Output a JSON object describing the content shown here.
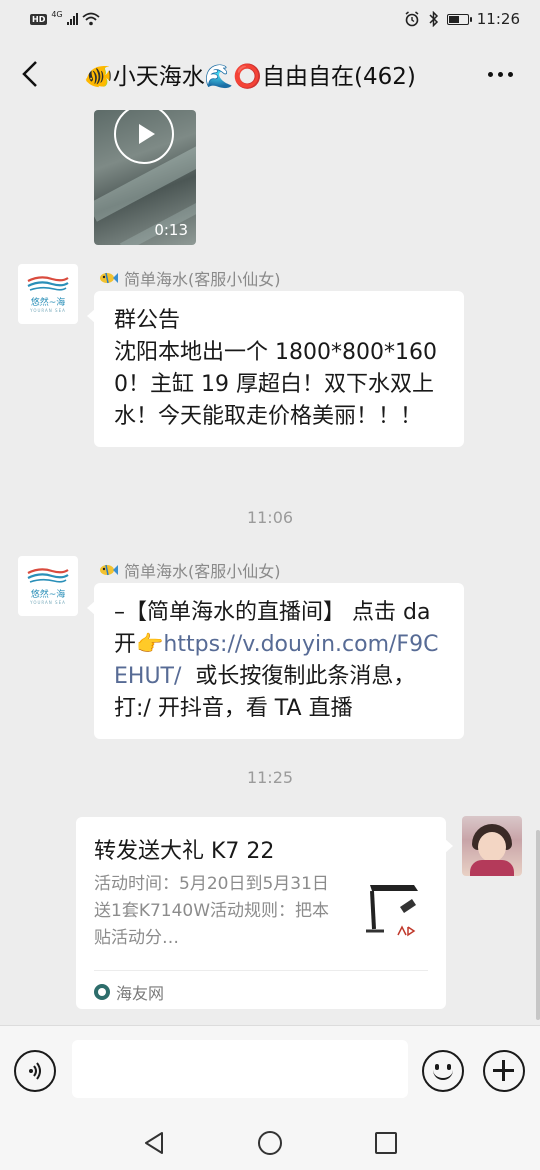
{
  "status_bar": {
    "hd": "HD",
    "network": "4G",
    "time": "11:26",
    "battery_level": 0.55
  },
  "header": {
    "title": "🐠小天海水🌊⭕自由自在(462)"
  },
  "chat": {
    "video": {
      "duration": "0:13"
    },
    "messages": [
      {
        "avatar_text": "悠然~海",
        "avatar_sub": "YOURAN SEA",
        "sender": "简单海水(客服小仙女)",
        "text": "群公告\n沈阳本地出一个 1800*800*1600！主缸 19 厚超白！双下水双上水！今天能取走价格美丽！！！"
      },
      {
        "timestamp": "11:06"
      },
      {
        "avatar_text": "悠然~海",
        "avatar_sub": "YOURAN SEA",
        "sender": "简单海水(客服小仙女)",
        "text_before": "–【简单海水的直播间】 点击 da 开",
        "link": "https://v.douyin.com/F9CEHUT/",
        "text_after": "  或长按復制此条消息，打:/ 开抖音，看 TA 直播"
      },
      {
        "timestamp": "11:25"
      }
    ],
    "share_card": {
      "title": "转发送大礼 K7 22",
      "description": "活动时间：5月20日到5月31日送1套K7140W活动规则：把本贴活动分…",
      "source": "海友网"
    }
  },
  "input_bar": {
    "placeholder": ""
  },
  "colors": {
    "background": "#ededed",
    "link": "#576b95",
    "bubble": "#ffffff"
  },
  "icons": [
    "back-icon",
    "more-icon",
    "play-icon",
    "voice-icon",
    "emoji-icon",
    "plus-icon",
    "nav-back-icon",
    "nav-home-icon",
    "nav-recents-icon"
  ]
}
